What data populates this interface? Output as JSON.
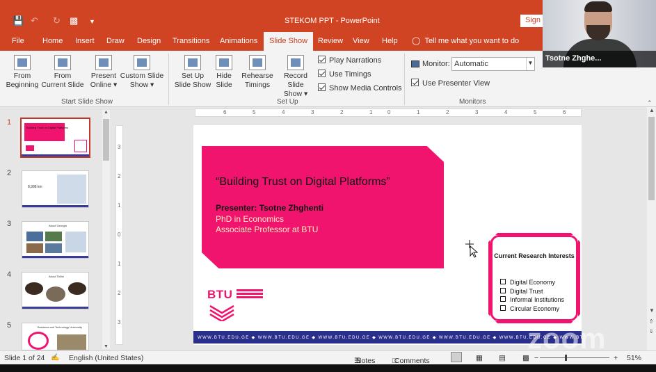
{
  "app": {
    "doc_title": "STEKOM PPT  -  PowerPoint",
    "sign_in": "Sign i"
  },
  "tabs": [
    {
      "label": "File"
    },
    {
      "label": "Home"
    },
    {
      "label": "Insert"
    },
    {
      "label": "Draw"
    },
    {
      "label": "Design"
    },
    {
      "label": "Transitions"
    },
    {
      "label": "Animations"
    },
    {
      "label": "Slide Show"
    },
    {
      "label": "Review"
    },
    {
      "label": "View"
    },
    {
      "label": "Help"
    }
  ],
  "tell_me": "Tell me what you want to do",
  "ribbon": {
    "start": {
      "from_beginning": [
        "From",
        "Beginning"
      ],
      "from_current": [
        "From",
        "Current Slide"
      ],
      "present_online": [
        "Present",
        "Online ▾"
      ],
      "custom_show": [
        "Custom Slide",
        "Show ▾"
      ],
      "label": "Start Slide Show"
    },
    "setup": {
      "set_up": [
        "Set Up",
        "Slide Show"
      ],
      "hide": [
        "Hide",
        "Slide"
      ],
      "rehearse": [
        "Rehearse",
        "Timings"
      ],
      "record": [
        "Record Slide",
        "Show ▾"
      ],
      "label": "Set Up",
      "checks": [
        "Play Narrations",
        "Use Timings",
        "Show Media Controls"
      ]
    },
    "monitors": {
      "monitor_label": "Monitor:",
      "monitor_value": "Automatic",
      "presenter_view": "Use Presenter View",
      "label": "Monitors"
    }
  },
  "webcam": {
    "name": "Tsotne Zhghe..."
  },
  "thumbnails": [
    {
      "num": "1",
      "caption": "Building Trust on Digital Platforms"
    },
    {
      "num": "2",
      "caption": "8,988 km"
    },
    {
      "num": "3",
      "caption": "About Georgia"
    },
    {
      "num": "4",
      "caption": "About Tbilisi"
    },
    {
      "num": "5",
      "caption": "Business and Technology University"
    }
  ],
  "ruler": {
    "h_ticks": [
      "6",
      "5",
      "4",
      "3",
      "2",
      "1",
      "0",
      "1",
      "2",
      "3",
      "4",
      "5",
      "6"
    ],
    "v_ticks": [
      "3",
      "2",
      "1",
      "0",
      "1",
      "2",
      "3"
    ]
  },
  "slide": {
    "title": "“Building Trust on Digital Platforms”",
    "presenter": "Presenter: Tsotne Zhghenti",
    "degree": "PhD in Economics",
    "position": "Associate Professor at BTU",
    "logo_text": "BTU",
    "research_title": "Current Research Interests",
    "research_items": [
      "Digital Economy",
      "Digital Trust",
      "Informal Institutions",
      "Circular Economy"
    ],
    "web_strip": "WWW.BTU.EDU.GE ◆ WWW.BTU.EDU.GE ◆ WWW.BTU.EDU.GE ◆ WWW.BTU.EDU.GE ◆ WWW.BTU.EDU.GE ◆ WWW.BTU.EDU.GE ◆ WWW.BTU.EDU.GE ◆ WWW.BTU.EDU.GE ◆ WWW.BTU.EDU.GE"
  },
  "status": {
    "slide_info": "Slide 1 of 24",
    "language": "English (United States)",
    "notes": "Notes",
    "comments": "Comments",
    "zoom": "51%"
  },
  "watermark": "zoom",
  "colors": {
    "accent": "#d04423",
    "brand_pink": "#f0146f",
    "strip_blue": "#2b2f8c"
  }
}
